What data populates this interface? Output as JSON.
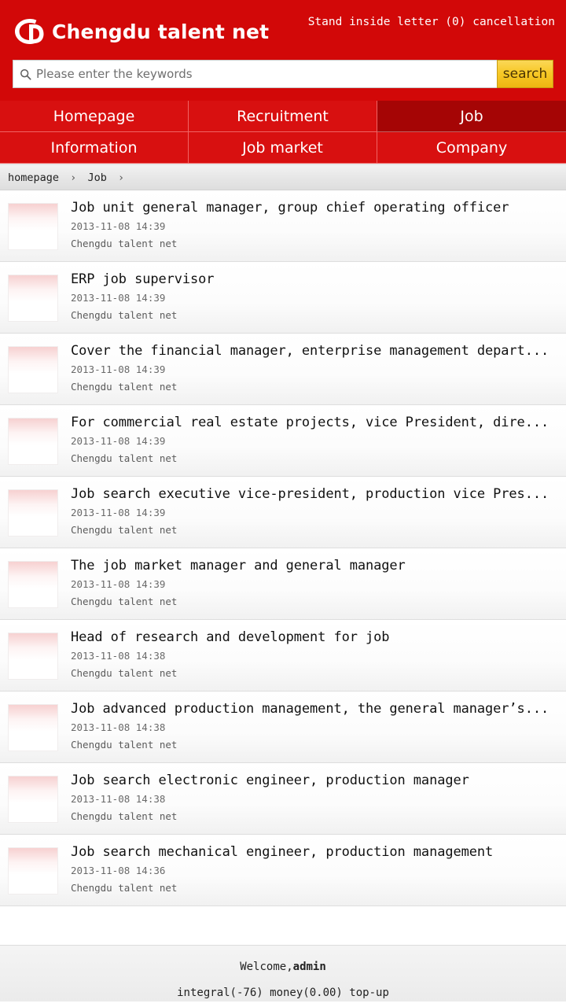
{
  "header": {
    "brand_name": "Chengdu talent net",
    "logo_icon": "cd-monogram-logo",
    "links": {
      "stand_inside_letter": "Stand inside letter",
      "letter_count": "(0)",
      "cancellation": "cancellation"
    }
  },
  "search": {
    "icon": "search-icon",
    "placeholder": "Please enter the keywords",
    "value": "",
    "button_label": "search"
  },
  "nav": {
    "items": [
      {
        "label": "Homepage",
        "active": false
      },
      {
        "label": "Recruitment",
        "active": false
      },
      {
        "label": "Job",
        "active": true
      },
      {
        "label": "Information",
        "active": false
      },
      {
        "label": "Job market",
        "active": false
      },
      {
        "label": "Company",
        "active": false
      }
    ]
  },
  "breadcrumb": {
    "items": [
      "homepage",
      "Job"
    ],
    "separator": "›"
  },
  "list": {
    "items": [
      {
        "title": "Job unit general manager, group chief operating officer",
        "date": "2013-11-08 14:39",
        "source": "Chengdu talent net"
      },
      {
        "title": "ERP job supervisor",
        "date": "2013-11-08 14:39",
        "source": "Chengdu talent net"
      },
      {
        "title": "Cover the financial manager, enterprise management depart...",
        "date": "2013-11-08 14:39",
        "source": "Chengdu talent net"
      },
      {
        "title": "For commercial real estate projects, vice President, dire...",
        "date": "2013-11-08 14:39",
        "source": "Chengdu talent net"
      },
      {
        "title": "Job search executive vice-president, production vice Pres...",
        "date": "2013-11-08 14:39",
        "source": "Chengdu talent net"
      },
      {
        "title": "The job market manager and general manager",
        "date": "2013-11-08 14:39",
        "source": "Chengdu talent net"
      },
      {
        "title": "Head of research and development for job",
        "date": "2013-11-08 14:38",
        "source": "Chengdu talent net"
      },
      {
        "title": "Job advanced production management, the general manager’s...",
        "date": "2013-11-08 14:38",
        "source": "Chengdu talent net"
      },
      {
        "title": "Job search electronic engineer, production manager",
        "date": "2013-11-08 14:38",
        "source": "Chengdu talent net"
      },
      {
        "title": "Job search mechanical engineer, production management",
        "date": "2013-11-08 14:36",
        "source": "Chengdu talent net"
      }
    ]
  },
  "footer": {
    "welcome_label": "Welcome,",
    "username": "admin",
    "integral": "integral(-76)",
    "money": "money(0.00)",
    "topup": "top-up"
  },
  "colors": {
    "header_red": "#d20808",
    "nav_red": "#d81010",
    "nav_active_red": "#a50505",
    "search_gold": "#f7c928",
    "text_dark": "#111111",
    "text_muted": "#6a6a6a"
  }
}
